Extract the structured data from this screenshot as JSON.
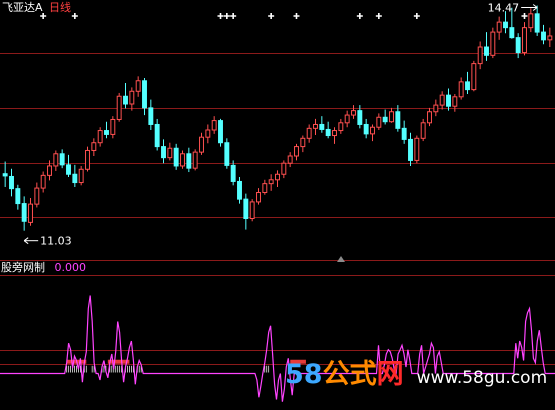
{
  "colors": {
    "background": "#000000",
    "grid": "#8b1a1a",
    "up": "#ff5050",
    "down": "#54ffff",
    "label_white": "#ffffff",
    "indicator": "#ff44ff",
    "accent_red": "#ff4040"
  },
  "header": {
    "stock_name": "飞亚达A",
    "period": "日线"
  },
  "chart_data": [
    {
      "type": "candlestick",
      "title": "飞亚达A 日线",
      "ylim": [
        10.5,
        15.2
      ],
      "grid_levels": [
        11.28,
        12.26,
        13.25,
        14.24
      ],
      "annotations": {
        "low_label": "11.03",
        "high_label": "14.47"
      },
      "signal_markers": [
        6,
        11,
        34,
        35,
        36,
        42,
        46,
        56,
        59,
        65,
        82
      ],
      "candles": [
        [
          12.06,
          12.28,
          11.82,
          12.02
        ],
        [
          12.01,
          12.15,
          11.65,
          11.79
        ],
        [
          11.79,
          11.86,
          11.41,
          11.52
        ],
        [
          11.52,
          11.65,
          11.03,
          11.2
        ],
        [
          11.18,
          11.62,
          11.12,
          11.51
        ],
        [
          11.51,
          11.9,
          11.45,
          11.8
        ],
        [
          11.8,
          12.1,
          11.72,
          12.03
        ],
        [
          12.03,
          12.3,
          11.94,
          12.2
        ],
        [
          12.2,
          12.48,
          12.11,
          12.42
        ],
        [
          12.42,
          12.5,
          12.16,
          12.22
        ],
        [
          12.22,
          12.4,
          12.0,
          12.05
        ],
        [
          12.05,
          12.22,
          11.82,
          11.9
        ],
        [
          11.9,
          12.2,
          11.85,
          12.14
        ],
        [
          12.14,
          12.55,
          12.1,
          12.48
        ],
        [
          12.48,
          12.7,
          12.38,
          12.62
        ],
        [
          12.62,
          12.9,
          12.55,
          12.84
        ],
        [
          12.84,
          13.0,
          12.7,
          12.77
        ],
        [
          12.77,
          13.1,
          12.7,
          13.04
        ],
        [
          13.04,
          13.52,
          13.0,
          13.46
        ],
        [
          13.46,
          13.7,
          13.24,
          13.32
        ],
        [
          13.32,
          13.62,
          13.2,
          13.55
        ],
        [
          13.55,
          13.82,
          13.45,
          13.74
        ],
        [
          13.74,
          13.79,
          13.12,
          13.25
        ],
        [
          13.25,
          13.4,
          12.85,
          12.95
        ],
        [
          12.95,
          13.05,
          12.48,
          12.55
        ],
        [
          12.55,
          12.68,
          12.25,
          12.35
        ],
        [
          12.35,
          12.62,
          12.3,
          12.52
        ],
        [
          12.52,
          12.6,
          12.13,
          12.2
        ],
        [
          12.2,
          12.48,
          12.15,
          12.42
        ],
        [
          12.42,
          12.53,
          12.09,
          12.16
        ],
        [
          12.16,
          12.5,
          12.12,
          12.45
        ],
        [
          12.45,
          12.8,
          12.4,
          12.72
        ],
        [
          12.72,
          12.95,
          12.61,
          12.85
        ],
        [
          12.85,
          13.1,
          12.78,
          13.02
        ],
        [
          13.02,
          13.05,
          12.55,
          12.62
        ],
        [
          12.62,
          12.7,
          12.15,
          12.21
        ],
        [
          12.21,
          12.3,
          11.85,
          11.92
        ],
        [
          11.92,
          12.0,
          11.52,
          11.6
        ],
        [
          11.6,
          11.7,
          11.05,
          11.25
        ],
        [
          11.25,
          11.6,
          11.2,
          11.55
        ],
        [
          11.55,
          11.8,
          11.5,
          11.72
        ],
        [
          11.72,
          11.95,
          11.68,
          11.88
        ],
        [
          11.88,
          12.05,
          11.75,
          11.95
        ],
        [
          11.95,
          12.12,
          11.82,
          12.05
        ],
        [
          12.05,
          12.3,
          11.98,
          12.25
        ],
        [
          12.25,
          12.45,
          12.18,
          12.38
        ],
        [
          12.38,
          12.6,
          12.3,
          12.55
        ],
        [
          12.55,
          12.75,
          12.45,
          12.7
        ],
        [
          12.7,
          12.95,
          12.62,
          12.88
        ],
        [
          12.88,
          13.05,
          12.76,
          12.95
        ],
        [
          12.95,
          13.1,
          12.8,
          12.86
        ],
        [
          12.86,
          13.0,
          12.7,
          12.75
        ],
        [
          12.75,
          12.9,
          12.6,
          12.84
        ],
        [
          12.84,
          13.05,
          12.78,
          12.98
        ],
        [
          12.98,
          13.2,
          12.9,
          13.12
        ],
        [
          13.12,
          13.3,
          13.05,
          13.2
        ],
        [
          13.2,
          13.3,
          12.88,
          12.95
        ],
        [
          12.95,
          13.05,
          12.7,
          12.78
        ],
        [
          12.78,
          12.95,
          12.65,
          12.9
        ],
        [
          12.9,
          13.15,
          12.85,
          13.08
        ],
        [
          13.08,
          13.22,
          12.95,
          13.0
        ],
        [
          13.0,
          13.25,
          12.98,
          13.18
        ],
        [
          13.18,
          13.3,
          12.82,
          12.88
        ],
        [
          12.88,
          13.02,
          12.6,
          12.68
        ],
        [
          12.68,
          12.8,
          12.2,
          12.3
        ],
        [
          12.3,
          12.75,
          12.25,
          12.7
        ],
        [
          12.7,
          13.05,
          12.65,
          12.98
        ],
        [
          12.98,
          13.25,
          12.92,
          13.18
        ],
        [
          13.18,
          13.4,
          13.1,
          13.3
        ],
        [
          13.3,
          13.55,
          13.22,
          13.48
        ],
        [
          13.48,
          13.6,
          13.2,
          13.28
        ],
        [
          13.28,
          13.5,
          13.18,
          13.45
        ],
        [
          13.45,
          13.8,
          13.4,
          13.72
        ],
        [
          13.72,
          13.9,
          13.5,
          13.58
        ],
        [
          13.58,
          14.1,
          13.55,
          14.05
        ],
        [
          14.05,
          14.45,
          13.95,
          14.35
        ],
        [
          14.35,
          14.62,
          14.1,
          14.2
        ],
        [
          14.2,
          14.7,
          14.15,
          14.62
        ],
        [
          14.62,
          14.9,
          14.48,
          14.8
        ],
        [
          14.8,
          15.0,
          14.6,
          14.7
        ],
        [
          14.7,
          15.06,
          14.5,
          14.52
        ],
        [
          14.52,
          14.6,
          14.15,
          14.25
        ],
        [
          14.25,
          14.8,
          14.2,
          14.7
        ],
        [
          14.7,
          15.05,
          14.62,
          14.95
        ],
        [
          14.95,
          15.1,
          14.55,
          14.62
        ],
        [
          14.62,
          14.75,
          14.4,
          14.48
        ],
        [
          14.48,
          14.7,
          14.35,
          14.55
        ]
      ]
    },
    {
      "type": "line",
      "title": "股旁网制",
      "value_label": "0.000",
      "baseline": 0,
      "ylim": [
        -30,
        90
      ],
      "reference_levels": [
        22,
        9
      ],
      "values": [
        0,
        0,
        0,
        0,
        0,
        0,
        0,
        0,
        0,
        0,
        0,
        0,
        0,
        0,
        0,
        0,
        0,
        0,
        0,
        0,
        0,
        0,
        0,
        0,
        0,
        0,
        0,
        0,
        0,
        0,
        0,
        0,
        0,
        0,
        10,
        28,
        22,
        5,
        16,
        12,
        4,
        14,
        -8,
        10,
        20,
        60,
        72,
        48,
        10,
        0,
        0,
        -6,
        6,
        12,
        2,
        -4,
        10,
        18,
        4,
        20,
        48,
        38,
        12,
        -8,
        6,
        14,
        24,
        30,
        12,
        -10,
        6,
        12,
        8,
        0,
        0,
        0,
        0,
        0,
        0,
        0,
        0,
        0,
        0,
        0,
        0,
        0,
        0,
        0,
        0,
        0,
        0,
        0,
        0,
        0,
        0,
        0,
        0,
        0,
        0,
        0,
        0,
        0,
        0,
        0,
        0,
        0,
        0,
        0,
        0,
        0,
        0,
        0,
        0,
        0,
        0,
        0,
        0,
        0,
        0,
        0,
        0,
        0,
        0,
        0,
        0,
        0,
        0,
        0,
        0,
        0,
        0,
        -6,
        -22,
        -12,
        0,
        10,
        22,
        38,
        44,
        18,
        -10,
        -24,
        -6,
        0,
        -26,
        -14,
        6,
        14,
        -4,
        -20,
        0,
        0,
        0,
        0,
        0,
        0,
        0,
        0,
        0,
        0,
        0,
        0,
        0,
        0,
        0,
        0,
        0,
        0,
        0,
        0,
        0,
        0,
        0,
        0,
        0,
        0,
        0,
        0,
        0,
        0,
        0,
        0,
        0,
        0,
        0,
        0,
        0,
        0,
        0,
        0,
        0,
        0,
        0,
        26,
        0,
        0,
        8,
        18,
        22,
        20,
        14,
        4,
        0,
        18,
        22,
        26,
        18,
        6,
        22,
        12,
        0,
        0,
        0,
        0,
        18,
        26,
        0,
        6,
        12,
        18,
        28,
        24,
        0,
        16,
        20,
        10,
        0,
        0,
        0,
        0,
        0,
        0,
        0,
        0,
        0,
        0,
        0,
        0,
        0,
        0,
        0,
        0,
        0,
        0,
        0,
        0,
        0,
        0,
        0,
        0,
        0,
        0,
        0,
        0,
        0,
        0,
        0,
        0,
        0,
        0,
        0,
        0,
        0,
        28,
        14,
        30,
        24,
        12,
        48,
        56,
        60,
        40,
        14,
        10,
        30,
        40,
        24,
        10,
        0,
        0,
        0,
        0,
        0,
        0
      ]
    }
  ]
}
